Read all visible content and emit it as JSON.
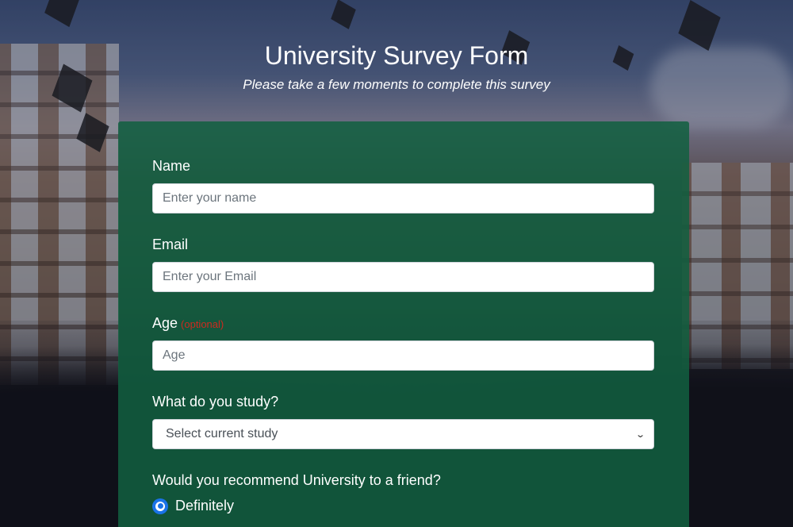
{
  "header": {
    "title": "University Survey Form",
    "subtitle": "Please take a few moments to complete this survey"
  },
  "form": {
    "name": {
      "label": "Name",
      "placeholder": "Enter your name",
      "value": ""
    },
    "email": {
      "label": "Email",
      "placeholder": "Enter your Email",
      "value": ""
    },
    "age": {
      "label": "Age",
      "optional_text": "(optional)",
      "placeholder": "Age",
      "value": ""
    },
    "study": {
      "label": "What do you study?",
      "selected": "Select current study"
    },
    "recommend": {
      "label": "Would you recommend University to a friend?",
      "options": [
        {
          "label": "Definitely",
          "checked": true
        }
      ]
    }
  },
  "colors": {
    "card_bg": "#126040",
    "optional_text": "#cc2a1f",
    "radio_accent": "#1a73e8"
  }
}
